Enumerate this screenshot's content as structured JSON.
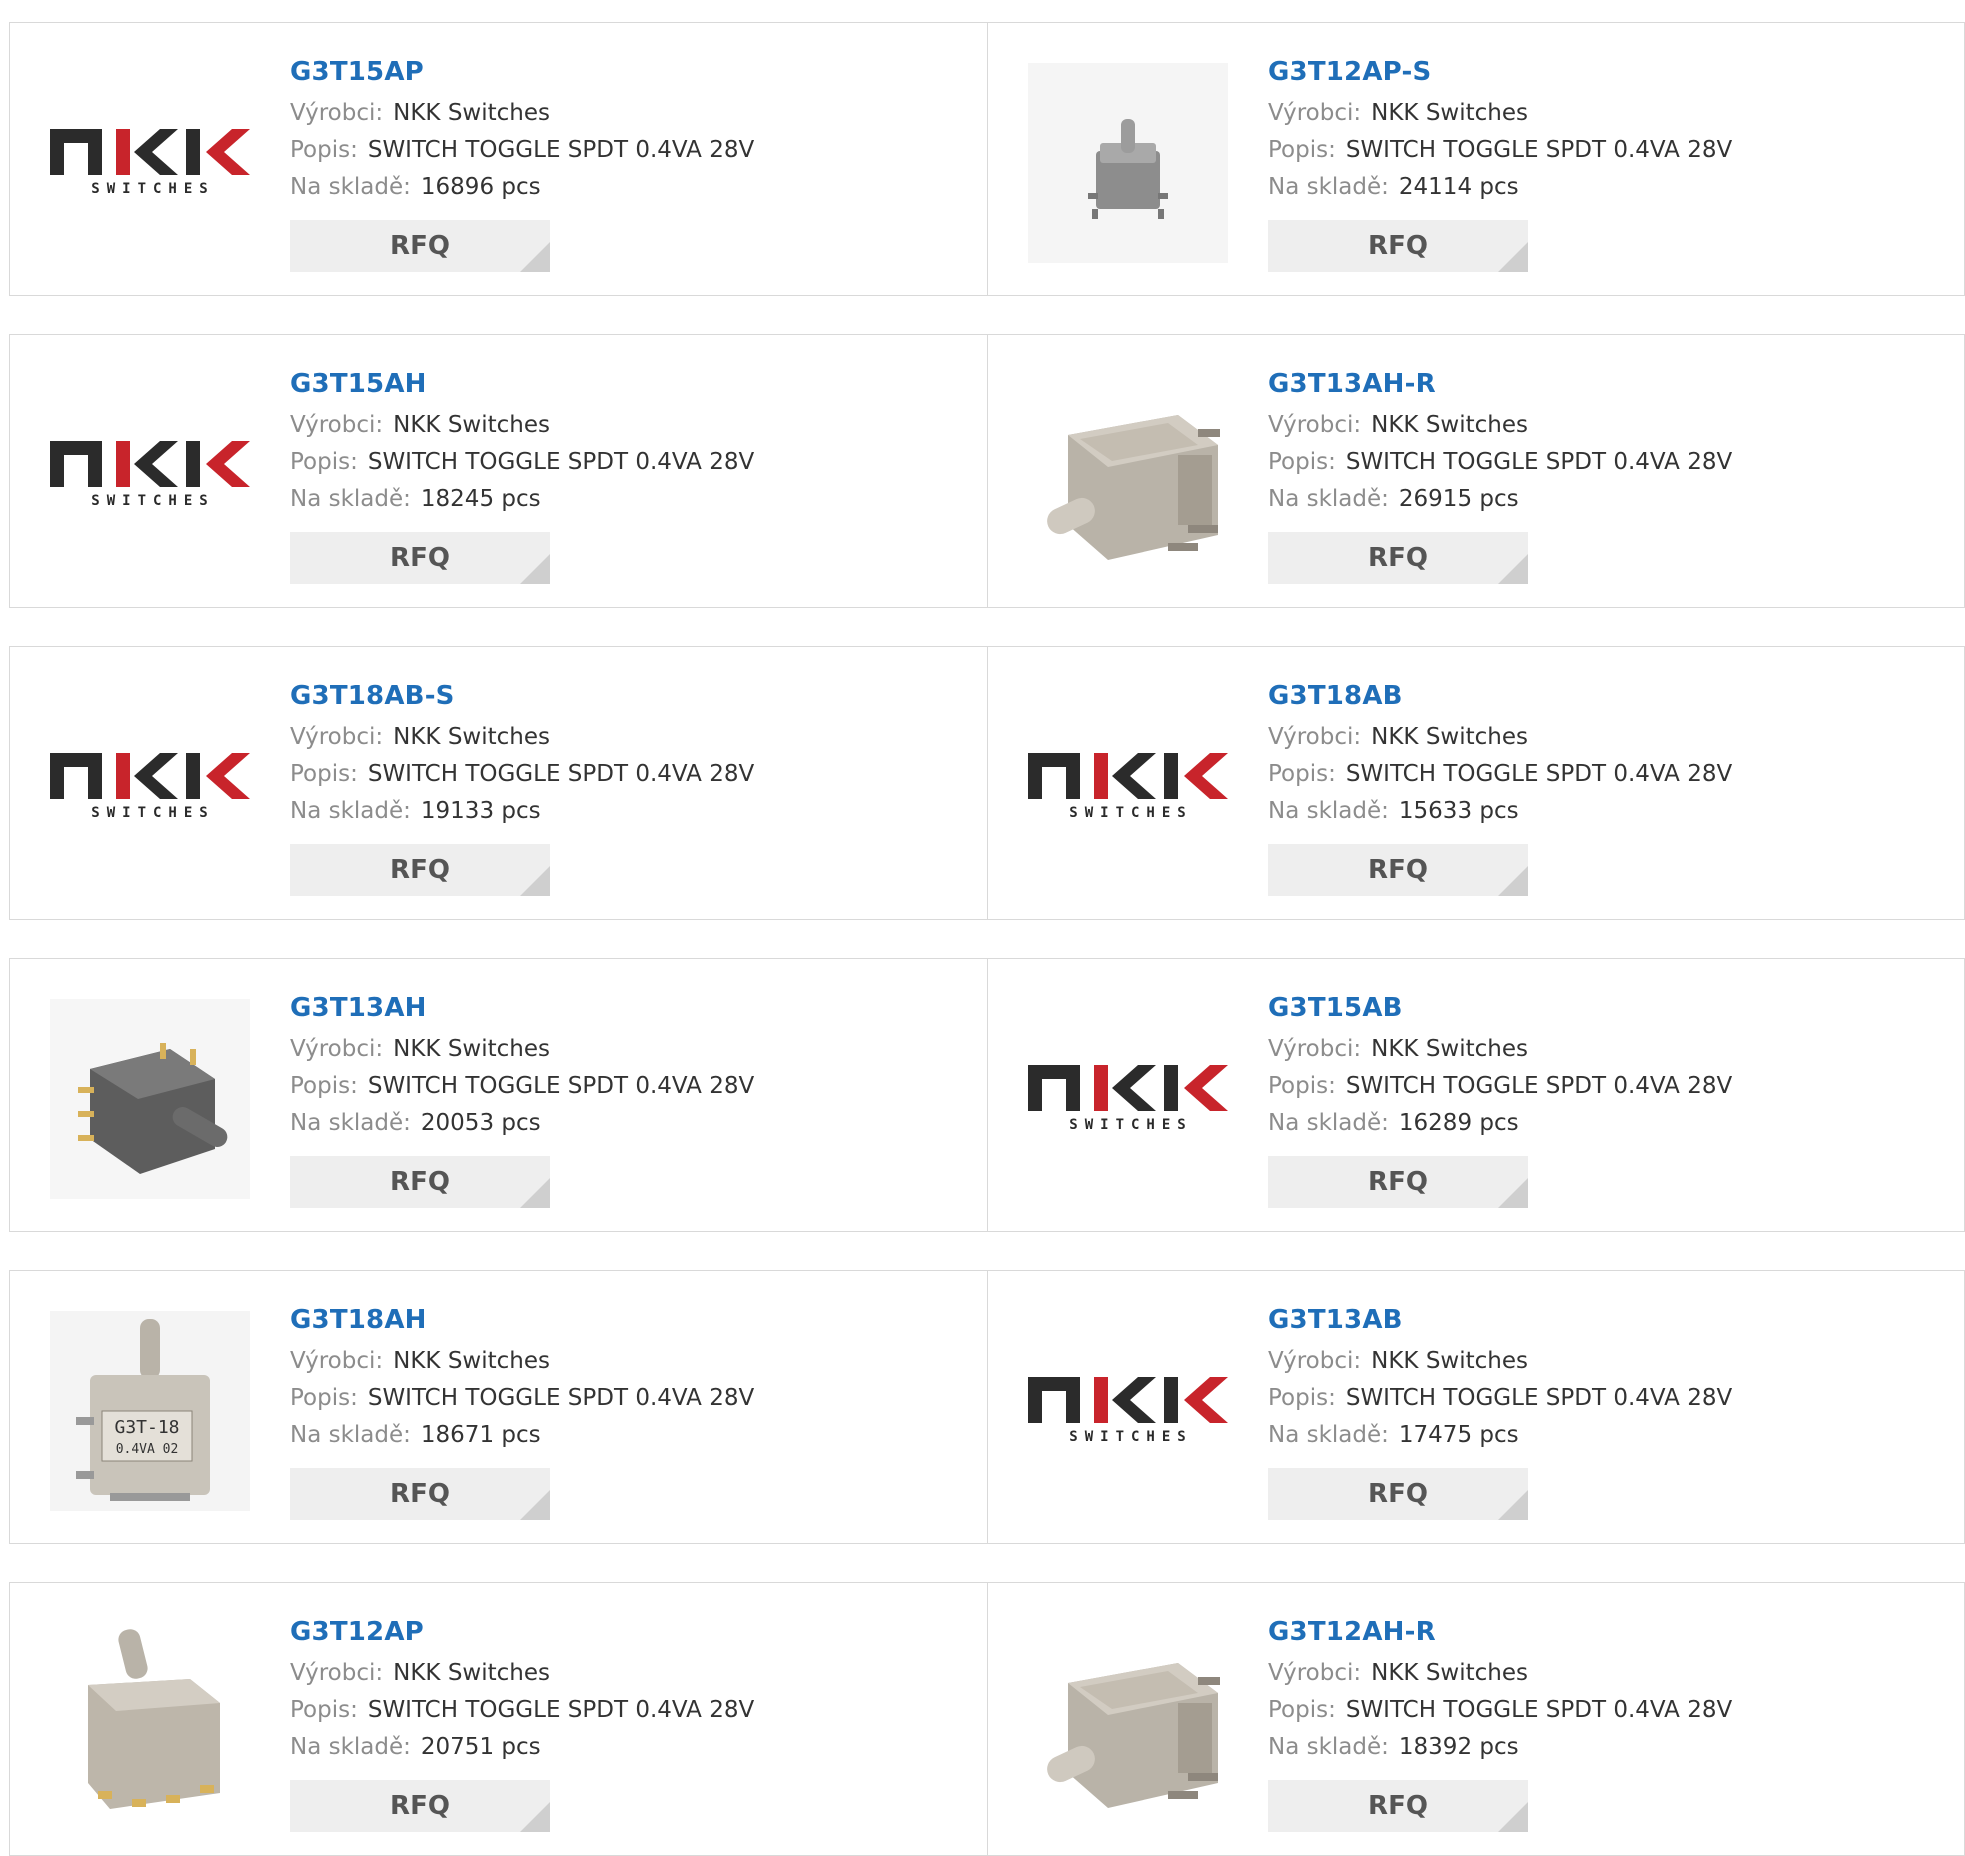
{
  "labels": {
    "manufacturer": "Výrobci:",
    "description": "Popis:",
    "stock": "Na skladě:",
    "rfq": "RFQ"
  },
  "logo": {
    "text": "SWITCHES",
    "brand_color": "#c8242b"
  },
  "products": [
    {
      "pn": "G3T15AP",
      "manufacturer": "NKK Switches",
      "description": "SWITCH TOGGLE SPDT 0.4VA 28V",
      "stock": "16896 pcs",
      "image": "nkk-logo"
    },
    {
      "pn": "G3T12AP-S",
      "manufacturer": "NKK Switches",
      "description": "SWITCH TOGGLE SPDT 0.4VA 28V",
      "stock": "24114 pcs",
      "image": "toggle-small"
    },
    {
      "pn": "G3T15AH",
      "manufacturer": "NKK Switches",
      "description": "SWITCH TOGGLE SPDT 0.4VA 28V",
      "stock": "18245 pcs",
      "image": "nkk-logo"
    },
    {
      "pn": "G3T13AH-R",
      "manufacturer": "NKK Switches",
      "description": "SWITCH TOGGLE SPDT 0.4VA 28V",
      "stock": "26915 pcs",
      "image": "toggle-horizontal"
    },
    {
      "pn": "G3T18AB-S",
      "manufacturer": "NKK Switches",
      "description": "SWITCH TOGGLE SPDT 0.4VA 28V",
      "stock": "19133 pcs",
      "image": "nkk-logo"
    },
    {
      "pn": "G3T18AB",
      "manufacturer": "NKK Switches",
      "description": "SWITCH TOGGLE SPDT 0.4VA 28V",
      "stock": "15633 pcs",
      "image": "nkk-logo"
    },
    {
      "pn": "G3T13AH",
      "manufacturer": "NKK Switches",
      "description": "SWITCH TOGGLE SPDT 0.4VA 28V",
      "stock": "20053 pcs",
      "image": "toggle-dark"
    },
    {
      "pn": "G3T15AB",
      "manufacturer": "NKK Switches",
      "description": "SWITCH TOGGLE SPDT 0.4VA 28V",
      "stock": "16289 pcs",
      "image": "nkk-logo"
    },
    {
      "pn": "G3T18AH",
      "manufacturer": "NKK Switches",
      "description": "SWITCH TOGGLE SPDT 0.4VA 28V",
      "stock": "18671 pcs",
      "image": "toggle-vertical-labeled",
      "image_text": [
        "G3T-18",
        "0.4VA 02"
      ]
    },
    {
      "pn": "G3T13AB",
      "manufacturer": "NKK Switches",
      "description": "SWITCH TOGGLE SPDT 0.4VA 28V",
      "stock": "17475 pcs",
      "image": "nkk-logo"
    },
    {
      "pn": "G3T12AP",
      "manufacturer": "NKK Switches",
      "description": "SWITCH TOGGLE SPDT 0.4VA 28V",
      "stock": "20751 pcs",
      "image": "toggle-vertical"
    },
    {
      "pn": "G3T12AH-R",
      "manufacturer": "NKK Switches",
      "description": "SWITCH TOGGLE SPDT 0.4VA 28V",
      "stock": "18392 pcs",
      "image": "toggle-horizontal"
    }
  ]
}
